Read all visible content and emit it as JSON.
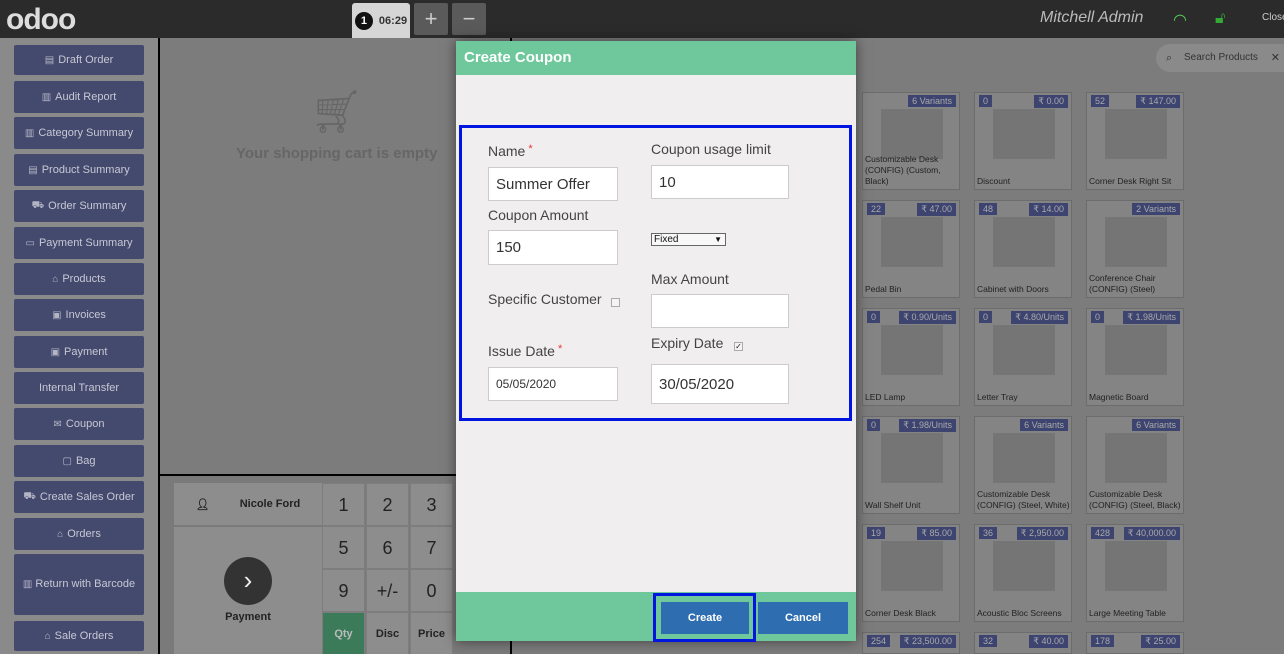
{
  "topbar": {
    "logo": "odoo",
    "order_number": "1",
    "order_time": "06:29",
    "add_order": "+",
    "remove_order": "−",
    "user": "Mitchell Admin",
    "close": "Close"
  },
  "sidebar": {
    "items": [
      {
        "label": "Draft Order",
        "icon": "file-icon"
      },
      {
        "label": "Audit Report",
        "icon": "chart-icon"
      },
      {
        "label": "Category Summary",
        "icon": "bar-chart-icon"
      },
      {
        "label": "Product Summary",
        "icon": "document-icon"
      },
      {
        "label": "Order Summary",
        "icon": "cart-icon"
      },
      {
        "label": "Payment Summary",
        "icon": "credit-card-icon"
      },
      {
        "label": "Products",
        "icon": "bank-icon"
      },
      {
        "label": "Invoices",
        "icon": "money-icon"
      },
      {
        "label": "Payment",
        "icon": "money-icon"
      },
      {
        "label": "Internal Transfer",
        "icon": ""
      },
      {
        "label": "Coupon",
        "icon": "gift-icon"
      },
      {
        "label": "Bag",
        "icon": "bag-icon"
      },
      {
        "label": "Create Sales Order",
        "icon": "cart-icon"
      },
      {
        "label": "Orders",
        "icon": "bank-icon"
      },
      {
        "label": "Return with Barcode",
        "icon": "barcode-icon"
      },
      {
        "label": "Sale Orders",
        "icon": "bank-icon"
      }
    ]
  },
  "cart": {
    "empty_text": "Your shopping cart is empty"
  },
  "customer": {
    "name": "Nicole Ford"
  },
  "payment": {
    "label": "Payment"
  },
  "numpad": {
    "keys": [
      "1",
      "2",
      "3",
      "5",
      "6",
      "7",
      "9",
      "+/-",
      "0",
      "Qty",
      "Disc",
      "Price"
    ]
  },
  "search": {
    "placeholder": "Search Products"
  },
  "products": [
    {
      "name": "Customizable Desk (CONFIG) (Custom, Black)",
      "left": "",
      "right": "6 Variants"
    },
    {
      "name": "Discount",
      "left": "0",
      "right": "₹ 0.00"
    },
    {
      "name": "Corner Desk Right Sit",
      "left": "52",
      "right": "₹ 147.00"
    },
    {
      "name": "Pedal Bin",
      "left": "22",
      "right": "₹ 47.00"
    },
    {
      "name": "Cabinet with Doors",
      "left": "48",
      "right": "₹ 14.00"
    },
    {
      "name": "Conference Chair (CONFIG) (Steel)",
      "left": "",
      "right": "2 Variants"
    },
    {
      "name": "LED Lamp",
      "left": "0",
      "right": "₹ 0.90/Units"
    },
    {
      "name": "Letter Tray",
      "left": "0",
      "right": "₹ 4.80/Units"
    },
    {
      "name": "Magnetic Board",
      "left": "0",
      "right": "₹ 1.98/Units"
    },
    {
      "name": "Wall Shelf Unit",
      "left": "0",
      "right": "₹ 1.98/Units"
    },
    {
      "name": "Customizable Desk (CONFIG) (Steel, White)",
      "left": "",
      "right": "6 Variants"
    },
    {
      "name": "Customizable Desk (CONFIG) (Steel, Black)",
      "left": "",
      "right": "6 Variants"
    },
    {
      "name": "Corner Desk Black",
      "left": "19",
      "right": "₹ 85.00"
    },
    {
      "name": "Acoustic Bloc Screens",
      "left": "36",
      "right": "₹ 2,950.00"
    },
    {
      "name": "Large Meeting Table",
      "left": "428",
      "right": "₹ 40,000.00"
    },
    {
      "name": "",
      "left": "254",
      "right": "₹ 23,500.00"
    },
    {
      "name": "",
      "left": "32",
      "right": "₹ 40.00"
    },
    {
      "name": "",
      "left": "178",
      "right": "₹ 25.00"
    }
  ],
  "dialog": {
    "title": "Create Coupon",
    "name_label": "Name",
    "name_value": "Summer Offer",
    "usage_limit_label": "Coupon usage limit",
    "usage_limit_value": "10",
    "amount_label": "Coupon Amount",
    "amount_value": "150",
    "amount_type": "Fixed",
    "specific_customer_label": "Specific Customer",
    "max_amount_label": "Max Amount",
    "max_amount_value": "",
    "issue_date_label": "Issue Date",
    "issue_date_value": "05/05/2020",
    "expiry_date_label": "Expiry Date",
    "expiry_date_value": "30/05/2020",
    "required_mark": "*",
    "create_label": "Create",
    "cancel_label": "Cancel"
  },
  "colors": {
    "dialog_header": "#6ec89b",
    "highlight": "#0015e0",
    "primary_button": "#2e6db0",
    "sidebar_button": "#434a6e"
  }
}
